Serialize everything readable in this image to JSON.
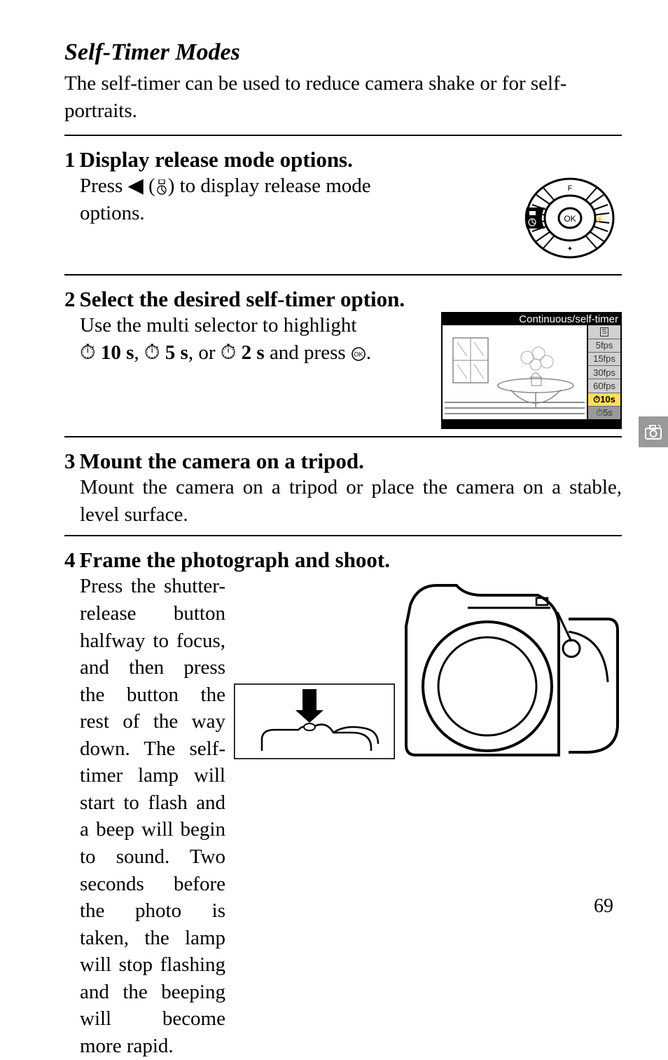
{
  "section_title": "Self-Timer Modes",
  "intro_line1": "The self-timer can be used to reduce camera shake or for self-",
  "intro_line2": "portraits.",
  "steps": {
    "s1": {
      "num": "1",
      "title": "Display release mode options.",
      "body_prefix": "Press ",
      "body_suffix1": " (",
      "body_suffix2": ") to display release mode",
      "body_line2": "options."
    },
    "s2": {
      "num": "2",
      "title": "Select the desired self-timer option.",
      "body_line1": "Use the multi selector to highlight",
      "val1": "10 s",
      "sep1": ", ",
      "val2": "5 s",
      "sep2": ", or ",
      "val3": "2 s",
      "tail": " and press ",
      "tail2": "."
    },
    "s3": {
      "num": "3",
      "title": "Mount the camera on a tripod.",
      "body": "Mount the camera on a tripod or place the camera on a stable, level surface."
    },
    "s4": {
      "num": "4",
      "title": "Frame the photograph and shoot.",
      "body": "Press the shutter-release button halfway to focus, and then press the button the rest of the way down. The self-timer lamp will start to flash and a beep will begin to sound. Two seconds before the photo is taken, the lamp will stop flashing and the beeping will become more rapid."
    }
  },
  "lcd": {
    "title": "Continuous/self-timer",
    "items": [
      "S",
      "5fps",
      "15fps",
      "30fps",
      "60fps",
      "⏱10s",
      "⏱5s"
    ],
    "selected_index": 5
  },
  "glyphs": {
    "left_arrow": "◀",
    "timer": "⏱",
    "ok_circ": "⊛",
    "release_icon": "▭"
  },
  "page_number": "69"
}
